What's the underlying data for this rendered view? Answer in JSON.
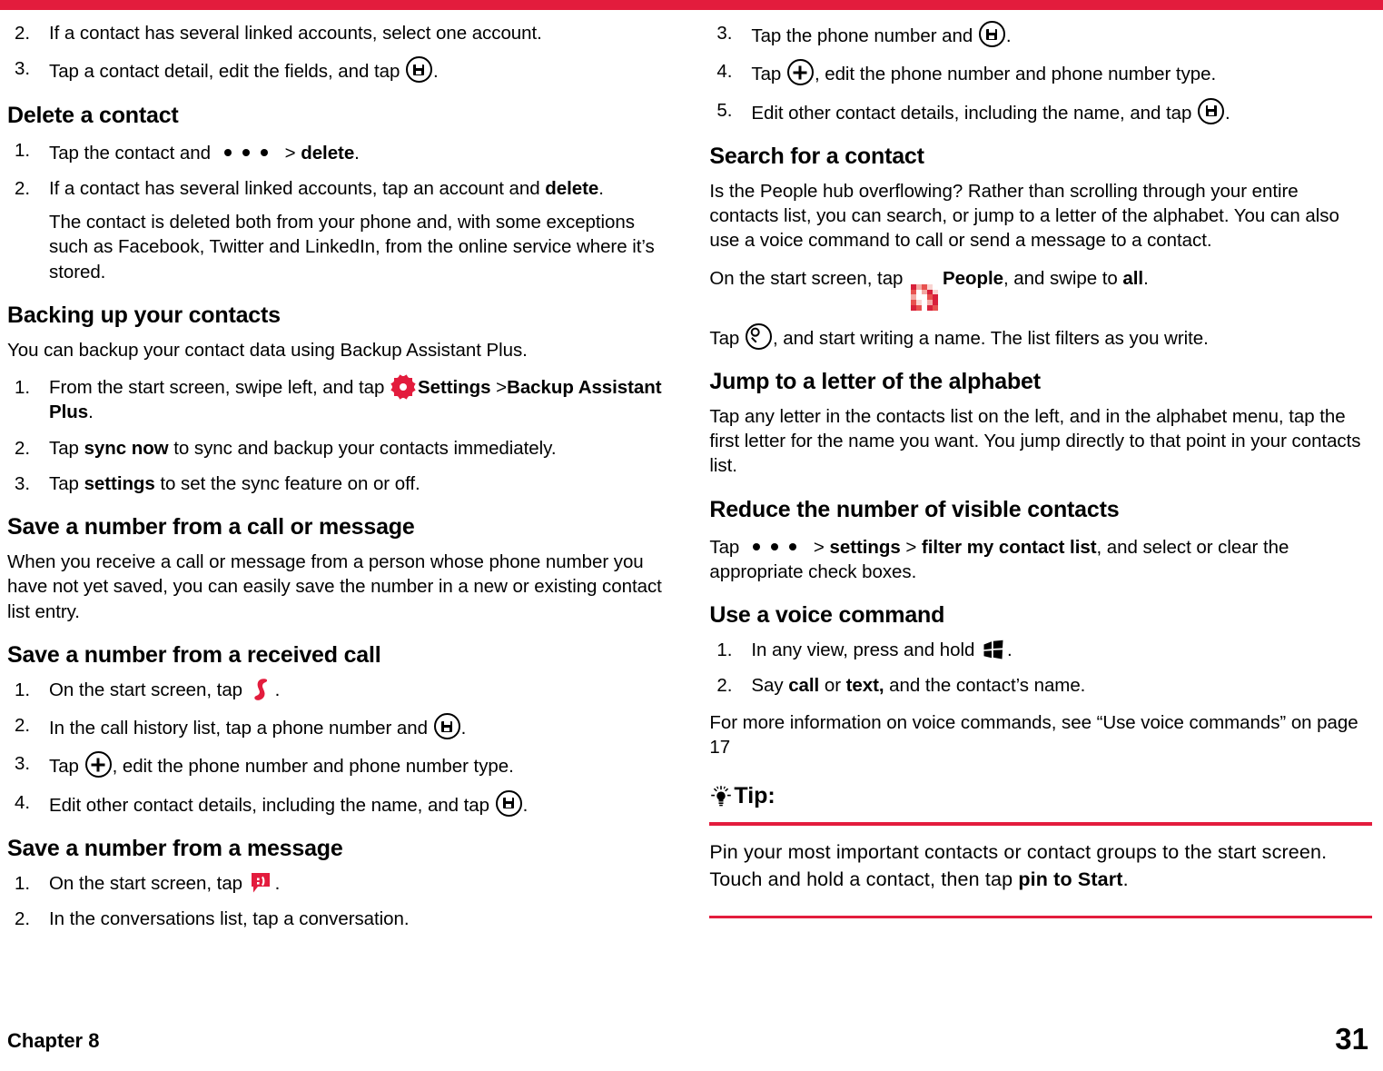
{
  "theme": {
    "accent_red": "#E31C3D",
    "text_black": "#000000",
    "page_background": "#FFFFFF"
  },
  "footer": {
    "chapter_label": "Chapter 8",
    "page_number": "31"
  },
  "left_column": {
    "continued_steps": [
      {
        "num": "2.",
        "text_before": "If a contact has several linked accounts, select one account.",
        "icon": "",
        "text_after": ""
      },
      {
        "num": "3.",
        "text_before": "Tap a contact detail, edit the fields, and tap ",
        "icon": "save-icon",
        "text_after": "."
      }
    ],
    "delete_contact": {
      "heading": "Delete a contact",
      "steps": [
        {
          "num": "1.",
          "pre": "Tap the contact and",
          "icon": "ellipsis-icon",
          "mid": " > ",
          "bold": "delete",
          "post": "."
        },
        {
          "num": "2.",
          "pre": "If a contact has several linked accounts, tap an account and ",
          "bold": "delete",
          "post": "."
        }
      ],
      "note": "The contact is deleted both from your phone and, with some exceptions such as Facebook, Twitter and LinkedIn, from the online service where it’s stored."
    },
    "backing_up": {
      "heading": "Backing up your contacts",
      "intro": "You can backup your contact data using Backup Assistant Plus.",
      "steps": [
        {
          "num": "1.",
          "pre": "From the start screen, swipe left, and tap ",
          "icon": "settings-gear-icon",
          "bold1": "Settings",
          "mid": " >",
          "bold2": "Backup Assistant Plus",
          "post": "."
        },
        {
          "num": "2.",
          "pre": "Tap ",
          "bold1": "sync now",
          "post": " to sync and backup your contacts immediately."
        },
        {
          "num": "3.",
          "pre": "Tap ",
          "bold1": "settings",
          "post": " to set the sync feature on or off."
        }
      ]
    },
    "save_number_call_message": {
      "heading": "Save a number from a call or message",
      "body": "When you receive a call or message from a person whose phone number you have not yet saved, you can easily save the number in a new or existing contact list entry."
    },
    "save_from_received_call": {
      "heading": "Save a number from a received call",
      "steps": [
        {
          "num": "1.",
          "pre": "On the start screen, tap ",
          "icon": "phone-icon",
          "post": "."
        },
        {
          "num": "2.",
          "pre": "In the call history list, tap a phone number and ",
          "icon": "save-icon",
          "post": "."
        },
        {
          "num": "3.",
          "pre": "Tap ",
          "icon": "plus-icon",
          "post": ", edit the phone number and phone number type."
        },
        {
          "num": "4.",
          "pre": "Edit other contact details, including the name, and tap ",
          "icon": "save-icon",
          "post": "."
        }
      ]
    },
    "save_from_message": {
      "heading": "Save a number from a message",
      "steps": [
        {
          "num": "1.",
          "pre": "On the start screen, tap ",
          "icon": "messaging-icon",
          "post": "."
        },
        {
          "num": "2.",
          "pre": "In the conversations list, tap a conversation.",
          "icon": "",
          "post": ""
        }
      ]
    }
  },
  "right_column": {
    "continued_steps": [
      {
        "num": "3.",
        "pre": "Tap the phone number and ",
        "icon": "save-icon",
        "post": "."
      },
      {
        "num": "4.",
        "pre": "Tap ",
        "icon": "plus-icon",
        "post": ", edit the phone number and phone number type."
      },
      {
        "num": "5.",
        "pre": "Edit other contact details, including the name, and tap ",
        "icon": "save-icon",
        "post": "."
      }
    ],
    "search_contact": {
      "heading": "Search for a contact",
      "body": "Is the People hub overflowing? Rather than scrolling through your entire contacts list, you can search, or jump to a letter of the alphabet. You can also use a voice command to call or send a message to a contact.",
      "line_people_pre": "On the start screen, tap ",
      "line_people_icon": "people-tile-icon",
      "line_people_bold1": "People",
      "line_people_mid": ", and swipe to ",
      "line_people_bold2": "all",
      "line_people_post": ".",
      "line_search_pre": "Tap ",
      "line_search_icon": "search-icon",
      "line_search_post": ", and start writing a name. The list filters as you write."
    },
    "jump_to_letter": {
      "heading": "Jump to a letter of the alphabet",
      "body": "Tap any letter in the contacts list on the left, and in the alphabet menu, tap the first letter for the name you want. You jump directly to that point in your contacts list."
    },
    "reduce_visible": {
      "heading": "Reduce the number of visible contacts",
      "pre": "Tap",
      "icon": "ellipsis-icon",
      "mid1": " > ",
      "bold1": "settings",
      "mid2": " > ",
      "bold2": "filter my contact list",
      "post": ", and select or clear the appropriate check boxes."
    },
    "voice_command": {
      "heading": "Use a voice command",
      "steps": [
        {
          "num": "1.",
          "pre": "In any view, press and hold ",
          "icon": "windows-start-icon",
          "post": "."
        },
        {
          "num": "2.",
          "pre": "Say ",
          "bold1": "call",
          "mid": " or ",
          "bold2": "text,",
          "post": " and the contact’s name."
        }
      ],
      "more_info": "For more information on voice commands, see “Use voice commands” on page 17"
    },
    "tip": {
      "icon": "lightbulb-icon",
      "label": "Tip:",
      "body_pre": "Pin your most important contacts or contact groups to the start screen. Touch and hold a contact, then tap ",
      "body_bold": "pin to Start",
      "body_post": "."
    }
  }
}
